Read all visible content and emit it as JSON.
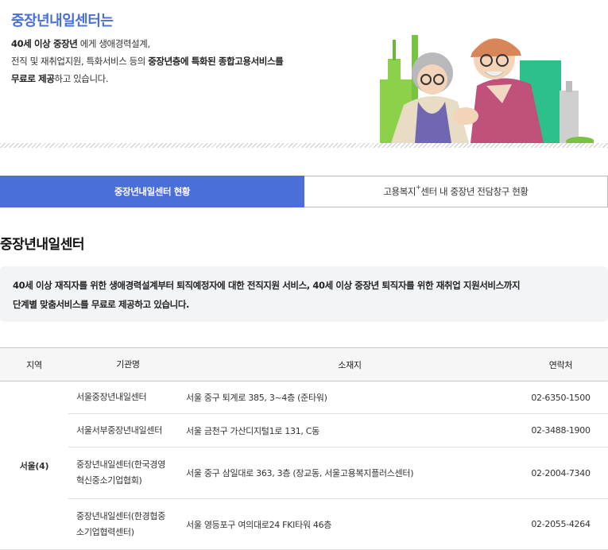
{
  "intro": {
    "title": "중장년내일센터는",
    "line1_bold": "40세 이상 중장년",
    "line1_rest": " 에게 생애경력설계,",
    "line2_start": "전직 및 재취업지원, 특화서비스 등의 ",
    "line2_bold": "중장년층에 특화된 종합고용서비스를",
    "line3_bold": "무료로 제공",
    "line3_rest": "하고 있습니다."
  },
  "tabs": {
    "active_label": "중장년내일센터 현황",
    "inactive_pre": "고용복지",
    "inactive_sup": "+",
    "inactive_post": "센터 내 중장년 전담창구 현황"
  },
  "section": {
    "title": "중장년내일센터",
    "desc1": "40세 이상 재직자를 위한 생애경력설계부터 퇴직예정자에 대한 전직지원 서비스, 40세 이상 중장년 퇴직자를 위한 재취업 지원서비스까지",
    "desc2": "단계별 맞춤서비스를 무료로 제공하고 있습니다."
  },
  "table": {
    "headers": {
      "region": "지역",
      "org": "기관명",
      "addr": "소재지",
      "tel": "연락처"
    },
    "region_seoul": "서울(4)",
    "rows": [
      {
        "org1": "서울중장년내일센터",
        "org2": "",
        "addr": "서울 중구 퇴계로 385, 3~4층 (준타워)",
        "tel": "02-6350-1500"
      },
      {
        "org1": "서울서부중장년내일센터",
        "org2": "",
        "addr": "서울 금천구 가산디지털1로 131, C동",
        "tel": "02-3488-1900"
      },
      {
        "org1": "중장년내일센터(한국경영",
        "org2": "혁신중소기업협회)",
        "addr": "서울 중구 삼일대로 363, 3층 (장교동, 서울고용복지플러스센터)",
        "tel": "02-2004-7340"
      },
      {
        "org1": "중장년내일센터(한경협중",
        "org2": "소기업협력센터)",
        "addr": "서울 영등포구 여의대로24 FKI타워 46층",
        "tel": "02-2055-4264"
      }
    ]
  }
}
